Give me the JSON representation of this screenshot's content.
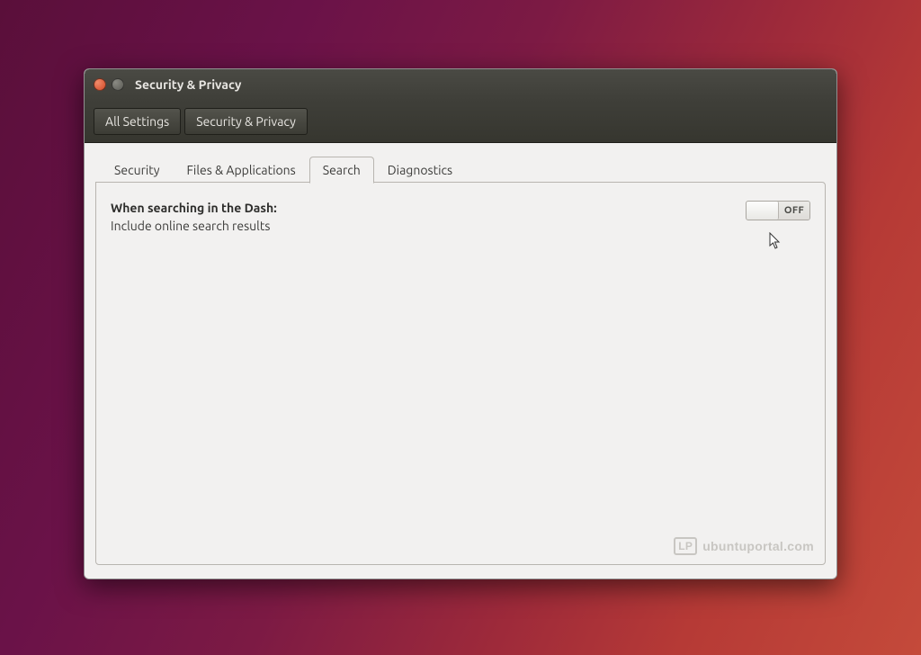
{
  "window": {
    "title": "Security & Privacy"
  },
  "breadcrumb": {
    "all_settings": "All Settings",
    "current": "Security & Privacy"
  },
  "tabs": {
    "security": "Security",
    "files": "Files & Applications",
    "search": "Search",
    "diagnostics": "Diagnostics",
    "active": "search"
  },
  "search_panel": {
    "heading": "When searching in the Dash:",
    "option_label": "Include online search results",
    "toggle_state": "OFF"
  },
  "watermark": {
    "badge": "LP",
    "text": "ubuntuportal.com"
  }
}
